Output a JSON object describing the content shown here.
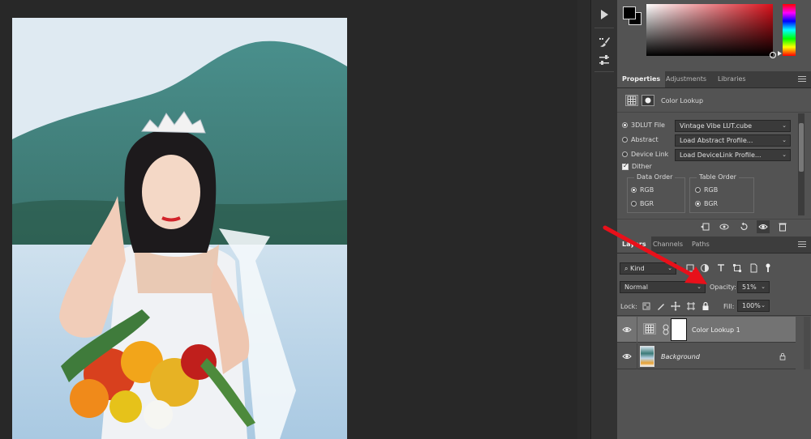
{
  "colors": {
    "panel_bg": "#535353",
    "tab_bar_bg": "#3d3d3d",
    "canvas_bg": "#282828",
    "annotation_arrow": "#e8101a"
  },
  "properties": {
    "tabs": [
      "Properties",
      "Adjustments",
      "Libraries"
    ],
    "adjustment_name": "Color Lookup",
    "options": {
      "lut_file_label": "3DLUT File",
      "lut_file_value": "Vintage Vibe LUT.cube",
      "abstract_label": "Abstract",
      "abstract_value": "Load Abstract Profile...",
      "device_link_label": "Device Link",
      "device_link_value": "Load DeviceLink Profile...",
      "dither_label": "Dither",
      "dither_checked": true,
      "data_order_title": "Data Order",
      "data_order_options": [
        "RGB",
        "BGR"
      ],
      "data_order_selected": "RGB",
      "table_order_title": "Table Order",
      "table_order_options": [
        "RGB",
        "BGR"
      ],
      "table_order_selected": "BGR"
    }
  },
  "layers_panel": {
    "tabs": [
      "Layers",
      "Channels",
      "Paths"
    ],
    "filter_kind": "Kind",
    "blend_mode": "Normal",
    "opacity_label": "Opacity:",
    "opacity_value": "51%",
    "lock_label": "Lock:",
    "fill_label": "Fill:",
    "fill_value": "100%",
    "layers": [
      {
        "name": "Color Lookup 1",
        "selected": true,
        "visible": true
      },
      {
        "name": "Background",
        "selected": false,
        "visible": true,
        "locked": true
      }
    ]
  },
  "toolbar_icons": [
    "play-icon",
    "brush-settings-icon",
    "adjustments-sliders-icon"
  ]
}
